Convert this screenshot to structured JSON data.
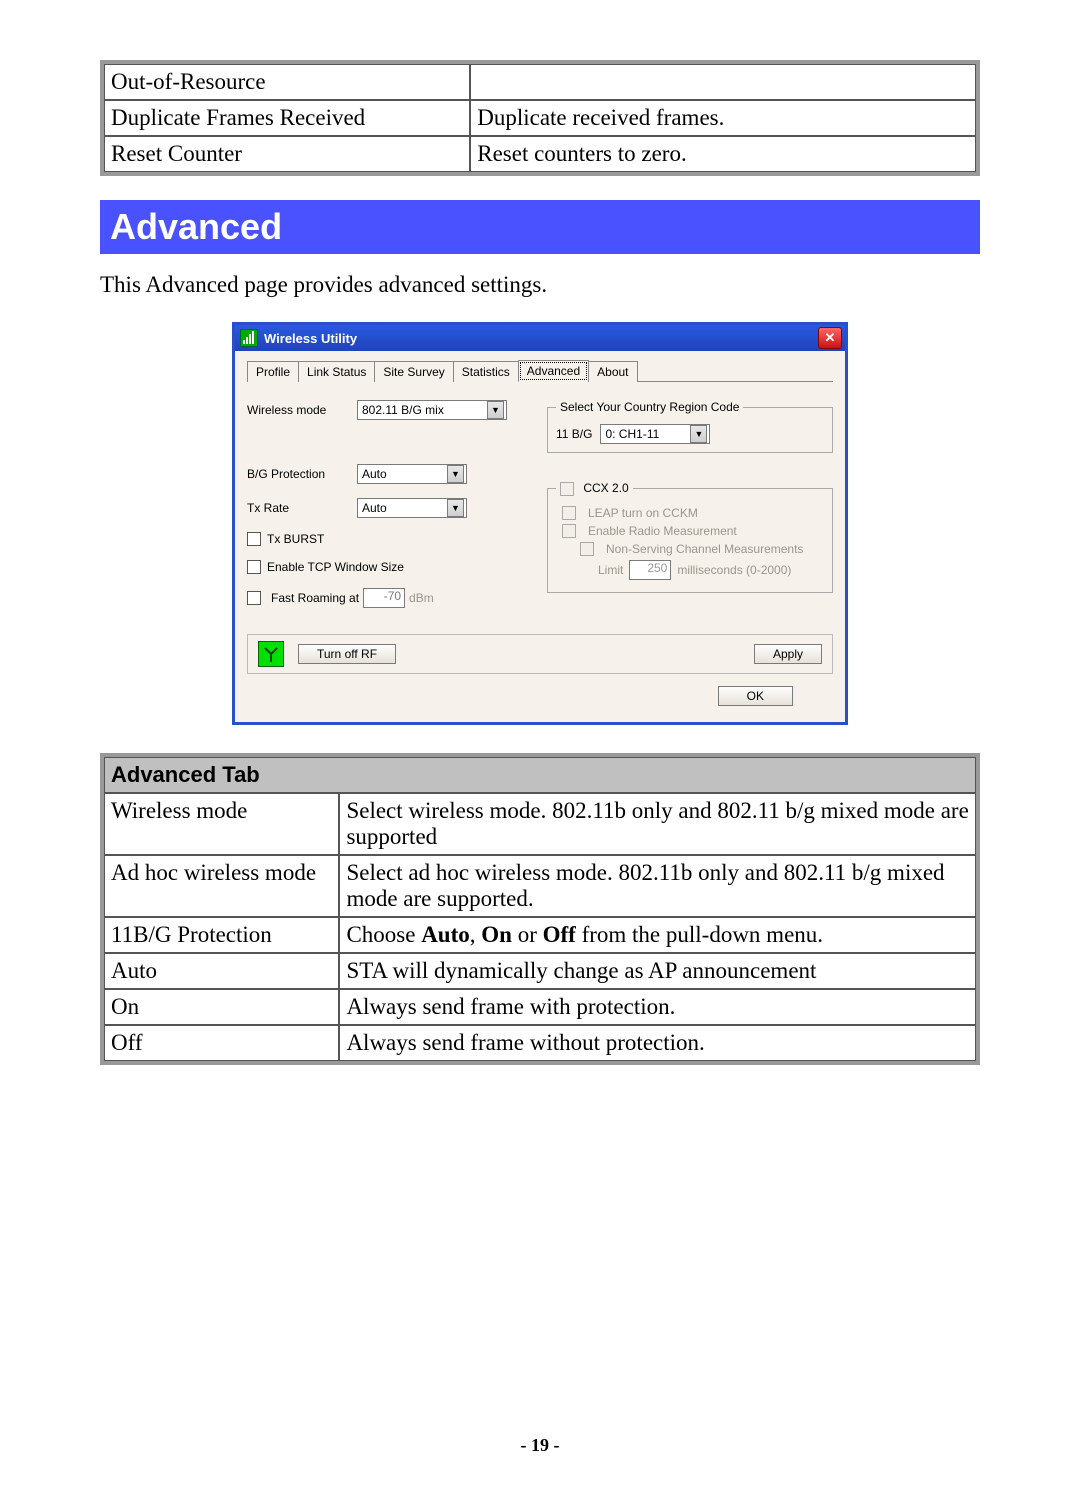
{
  "top_table": {
    "rows": [
      {
        "l": "Out-of-Resource",
        "r": ""
      },
      {
        "l": "Duplicate Frames Received",
        "r": "Duplicate received frames."
      },
      {
        "l": "Reset Counter",
        "r": "Reset counters to zero."
      }
    ]
  },
  "section_title": "Advanced",
  "intro_text": "This Advanced page provides advanced settings.",
  "dialog": {
    "title": "Wireless Utility",
    "close": "✕",
    "tabs": [
      "Profile",
      "Link Status",
      "Site Survey",
      "Statistics",
      "Advanced",
      "About"
    ],
    "active_tab_index": 4,
    "wireless_mode_label": "Wireless mode",
    "wireless_mode_value": "802.11 B/G mix",
    "region_legend": "Select Your Country Region Code",
    "region_label": "11 B/G",
    "region_value": "0: CH1-11",
    "bg_protection_label": "B/G Protection",
    "bg_protection_value": "Auto",
    "txrate_label": "Tx Rate",
    "txrate_value": "Auto",
    "txburst_label": "Tx BURST",
    "enable_tcp_label": "Enable TCP Window Size",
    "fast_roaming_label": "Fast Roaming at",
    "fast_roaming_value": "-70",
    "fast_roaming_unit": "dBm",
    "ccx_legend": "CCX 2.0",
    "leap_label": "LEAP turn on CCKM",
    "enable_radio_label": "Enable Radio Measurement",
    "nonserving_label": "Non-Serving Channel Measurements",
    "limit_label": "Limit",
    "limit_value": "250",
    "limit_unit": "milliseconds (0-2000)",
    "turn_off_rf": "Turn off RF",
    "apply": "Apply",
    "ok": "OK"
  },
  "adv_tab_header": "Advanced Tab",
  "adv_table": {
    "rows": [
      {
        "l": "Wireless mode",
        "r": "Select wireless mode. 802.11b only and 802.11 b/g mixed mode are supported"
      },
      {
        "l": "Ad hoc wireless mode",
        "r": "Select ad hoc wireless mode. 802.11b only and 802.11 b/g mixed mode are supported."
      },
      {
        "l": "11B/G Protection",
        "r_html": "Choose <b>Auto</b>, <b>On</b> or <b>Off</b> from the pull-down menu."
      },
      {
        "l": "Auto",
        "r": "STA will dynamically change as AP announcement"
      },
      {
        "l": "On",
        "r": "Always send frame with protection."
      },
      {
        "l": "Off",
        "r": "Always send frame without protection."
      }
    ]
  },
  "page_number": "- 19 -"
}
